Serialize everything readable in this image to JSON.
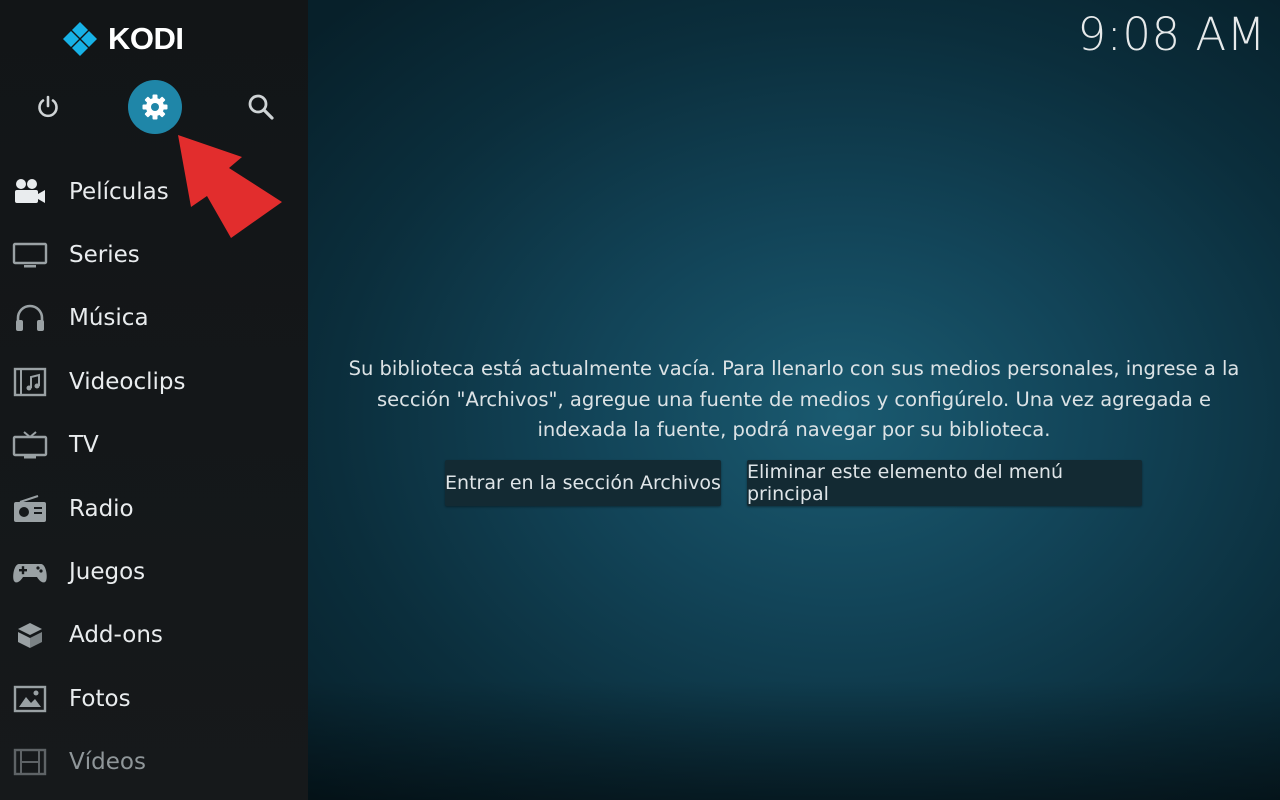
{
  "app": {
    "logo_text": "KODI"
  },
  "clock": "9:08 AM",
  "sidebar": {
    "top_buttons": [
      {
        "name": "power",
        "icon": "power-icon"
      },
      {
        "name": "settings",
        "icon": "gear-icon",
        "selected": true
      },
      {
        "name": "search",
        "icon": "search-icon"
      }
    ],
    "items": [
      {
        "label": "Películas",
        "icon": "movie-camera-icon"
      },
      {
        "label": "Series",
        "icon": "monitor-icon"
      },
      {
        "label": "Música",
        "icon": "headphones-icon"
      },
      {
        "label": "Videoclips",
        "icon": "film-music-icon"
      },
      {
        "label": "TV",
        "icon": "tv-icon"
      },
      {
        "label": "Radio",
        "icon": "radio-icon"
      },
      {
        "label": "Juegos",
        "icon": "gamepad-icon"
      },
      {
        "label": "Add-ons",
        "icon": "box-icon"
      },
      {
        "label": "Fotos",
        "icon": "picture-icon"
      },
      {
        "label": "Vídeos",
        "icon": "film-strip-icon"
      }
    ]
  },
  "main": {
    "empty_message": "Su biblioteca está actualmente vacía. Para llenarlo con sus medios personales, ingrese a la sección \"Archivos\", agregue una fuente de medios y configúrelo. Una vez agregada e indexada la fuente, podrá navegar por su biblioteca.",
    "buttons": {
      "enter_files": "Entrar en la sección Archivos",
      "remove_item": "Eliminar este elemento del menú principal"
    }
  },
  "colors": {
    "accent": "#1f86a8",
    "arrow": "#e22d2d",
    "sidebar_bg": "#141719",
    "kodi_blue": "#17b2e7"
  }
}
